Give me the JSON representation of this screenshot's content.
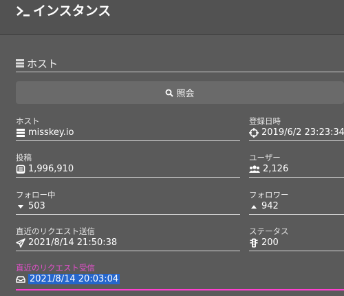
{
  "header": {
    "title": "インスタンス",
    "icon": "terminal-icon"
  },
  "section": {
    "title": "ホスト",
    "icon": "server-icon"
  },
  "lookup": {
    "label": "照会",
    "icon": "search-icon"
  },
  "fields": {
    "host": {
      "label": "ホスト",
      "value": "misskey.io",
      "icon": "globe-icon"
    },
    "registered": {
      "label": "登録日時",
      "value": "2019/6/2 23:23:34",
      "icon": "crosshairs-icon"
    },
    "notes": {
      "label": "投稿",
      "value": "1,996,910",
      "icon": "note-icon"
    },
    "users": {
      "label": "ユーザー",
      "value": "2,126",
      "icon": "users-icon"
    },
    "following": {
      "label": "フォロー中",
      "value": "503",
      "icon": "caret-down-icon"
    },
    "followers": {
      "label": "フォロワー",
      "value": "942",
      "icon": "caret-up-icon"
    },
    "latest_sent": {
      "label": "直近のリクエスト送信",
      "value": "2021/8/14 21:50:38",
      "icon": "paper-plane-icon"
    },
    "status": {
      "label": "ステータス",
      "value": "200",
      "icon": "traffic-light-icon"
    },
    "latest_received": {
      "label": "直近のリクエスト受信",
      "value": "2021/8/14 20:03:04",
      "icon": "inbox-icon"
    }
  },
  "colors": {
    "background": "#5a5a5a",
    "accent": "#ff40d0",
    "selection": "#2566cc"
  }
}
